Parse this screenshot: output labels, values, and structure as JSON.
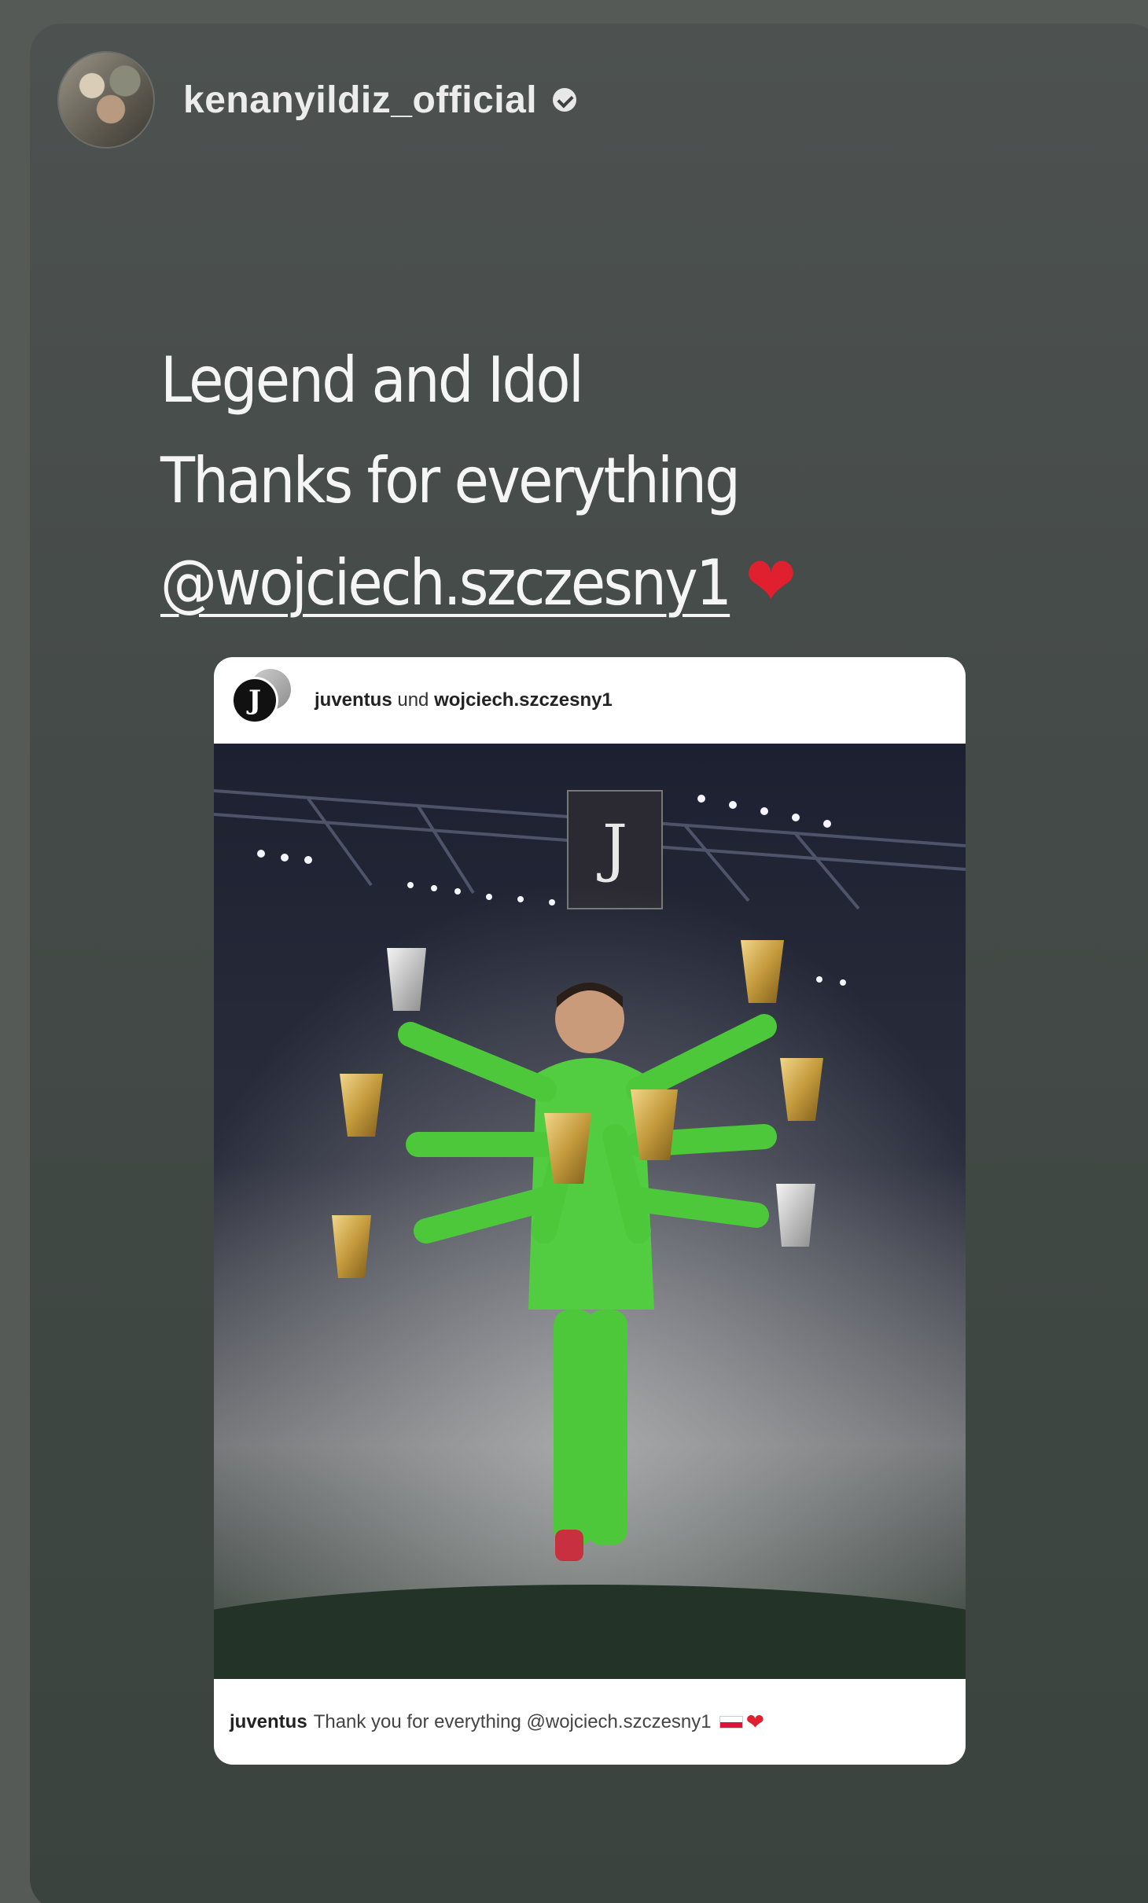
{
  "story": {
    "username": "kenanyildiz_official",
    "verified_icon": "verified-badge-icon"
  },
  "message": {
    "line1": "Legend and Idol",
    "line2": "Thanks for everything",
    "mention": "@wojciech.szczesny1",
    "heart": "❤"
  },
  "post": {
    "author1": "juventus",
    "joiner": "und",
    "author2": "wojciech.szczesny1",
    "juve_logo_letter": "J",
    "caption_user": "juventus",
    "caption_text": "Thank you for everything @wojciech.szczesny1",
    "caption_heart": "❤"
  },
  "colors": {
    "background": "#555a57",
    "goalkeeper_kit": "#4cc83a",
    "heart": "#e0202e"
  }
}
